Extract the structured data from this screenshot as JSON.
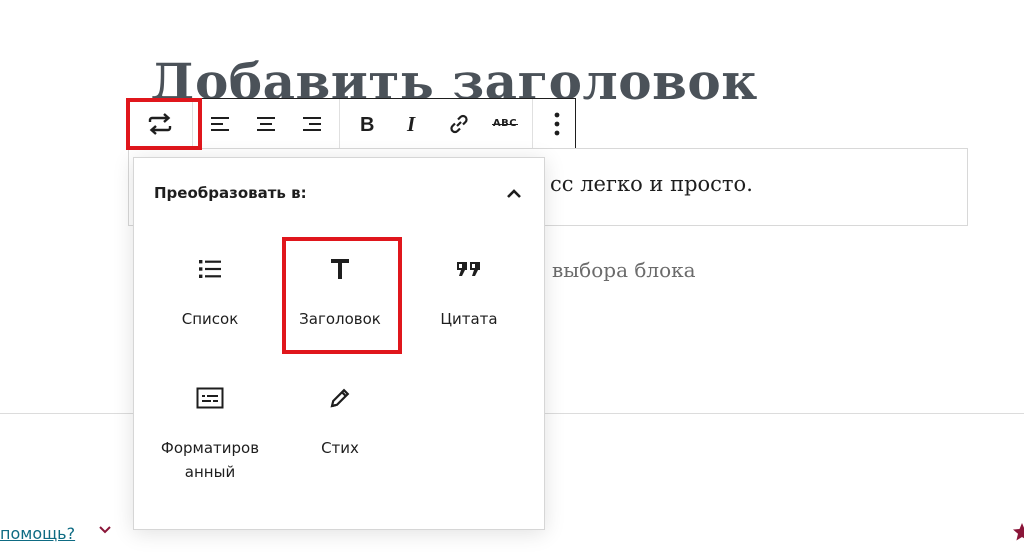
{
  "editor": {
    "title": "Добавить заголовок",
    "paragraph_visible": "сс легко и просто.",
    "placeholder_visible": "выбора блока"
  },
  "toolbar": {
    "transform_icon": "transform-arrows-icon",
    "align_left_icon": "align-left-icon",
    "align_center_icon": "align-center-icon",
    "align_right_icon": "align-right-icon",
    "bold_icon": "bold-icon",
    "italic_icon": "italic-icon",
    "link_icon": "link-icon",
    "strikethrough_label": "ABC",
    "more_icon": "more-vertical-icon"
  },
  "transform_menu": {
    "title": "Преобразовать в:",
    "collapse_icon": "chevron-up-icon",
    "items": [
      {
        "label": "Список",
        "icon": "list-icon"
      },
      {
        "label": "Заголовок",
        "icon": "heading-icon"
      },
      {
        "label": "Цитата",
        "icon": "quote-icon"
      },
      {
        "label": "Форматированный",
        "label_line1": "Форматиров",
        "label_line2": "анный",
        "icon": "preformatted-icon"
      },
      {
        "label": "Стих",
        "icon": "verse-pen-icon"
      }
    ]
  },
  "footer": {
    "help_text": "помощь?",
    "chevron_icon": "chevron-down-icon",
    "star_icon": "star-icon"
  },
  "colors": {
    "highlight": "#e0161c",
    "title": "#4b5259",
    "link": "#0e6b83",
    "chevron": "#8a1538"
  }
}
